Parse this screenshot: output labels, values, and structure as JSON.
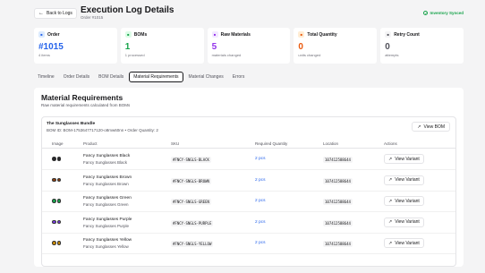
{
  "header": {
    "back_label": "Back to Logs",
    "title": "Execution Log Details",
    "subtitle": "Order #1015",
    "sync_status": "Inventory Synced"
  },
  "cards": [
    {
      "key": "order",
      "label": "Order",
      "value": "#1015",
      "sub": "4 items",
      "accent": "#2563eb",
      "bg": "#dbeafe",
      "icon": "receipt-icon"
    },
    {
      "key": "boms",
      "label": "BOMs",
      "value": "1",
      "sub": "1 processed",
      "accent": "#16a34a",
      "bg": "#dcfce7",
      "icon": "layers-icon"
    },
    {
      "key": "raw",
      "label": "Raw Materials",
      "value": "5",
      "sub": "materials changed",
      "accent": "#9333ea",
      "bg": "#f3e8ff",
      "icon": "box-icon"
    },
    {
      "key": "qty",
      "label": "Total Quantity",
      "value": "0",
      "sub": "units changed",
      "accent": "#ea580c",
      "bg": "#ffedd5",
      "icon": "trend-icon"
    },
    {
      "key": "retry",
      "label": "Retry Count",
      "value": "0",
      "sub": "attempts",
      "accent": "#52525b",
      "bg": "#f4f4f5",
      "icon": "refresh-icon"
    }
  ],
  "tabs": [
    "Timeline",
    "Order Details",
    "BOM Details",
    "Material Requirements",
    "Material Changes",
    "Errors"
  ],
  "active_tab": 3,
  "panel": {
    "title": "Material Requirements",
    "description": "Raw material requirements calculated from BOMs",
    "bundle_name": "The Sunglasses Bundle",
    "bundle_meta": "BOM ID: BOM-1753647717120-o8mw60nn • Order Quantity: 2",
    "view_bom_label": "View BOM"
  },
  "table": {
    "headers": [
      "Image",
      "Product",
      "SKU",
      "Required Quantity",
      "Location",
      "Actions"
    ],
    "rows": [
      {
        "name": "Fancy Sunglasses Black",
        "variant": "Fancy Sunglasses Black",
        "sku": "#FNCY-SNGLS-BLACK",
        "qty": "2 pcs",
        "location": "107412588644",
        "action": "View Variant",
        "color": "#27272a"
      },
      {
        "name": "Fancy Sunglasses Brown",
        "variant": "Fancy Sunglasses Brown",
        "sku": "#FNCY-SNGLS-BROWN",
        "qty": "2 pcs",
        "location": "107412588644",
        "action": "View Variant",
        "color": "#92400e"
      },
      {
        "name": "Fancy Sunglasses Green",
        "variant": "Fancy Sunglasses Green",
        "sku": "#FNCY-SNGLS-GREEN",
        "qty": "2 pcs",
        "location": "107412588644",
        "action": "View Variant",
        "color": "#16a34a"
      },
      {
        "name": "Fancy Sunglasses Purple",
        "variant": "Fancy Sunglasses Purple",
        "sku": "#FNCY-SNGLS-PURPLE",
        "qty": "2 pcs",
        "location": "107412588644",
        "action": "View Variant",
        "color": "#7c3aed"
      },
      {
        "name": "Fancy Sunglasses Yellow",
        "variant": "Fancy Sunglasses Yellow",
        "sku": "#FNCY-SNGLS-YELLOW",
        "qty": "2 pcs",
        "location": "107412588644",
        "action": "View Variant",
        "color": "#ca8a04"
      }
    ]
  }
}
